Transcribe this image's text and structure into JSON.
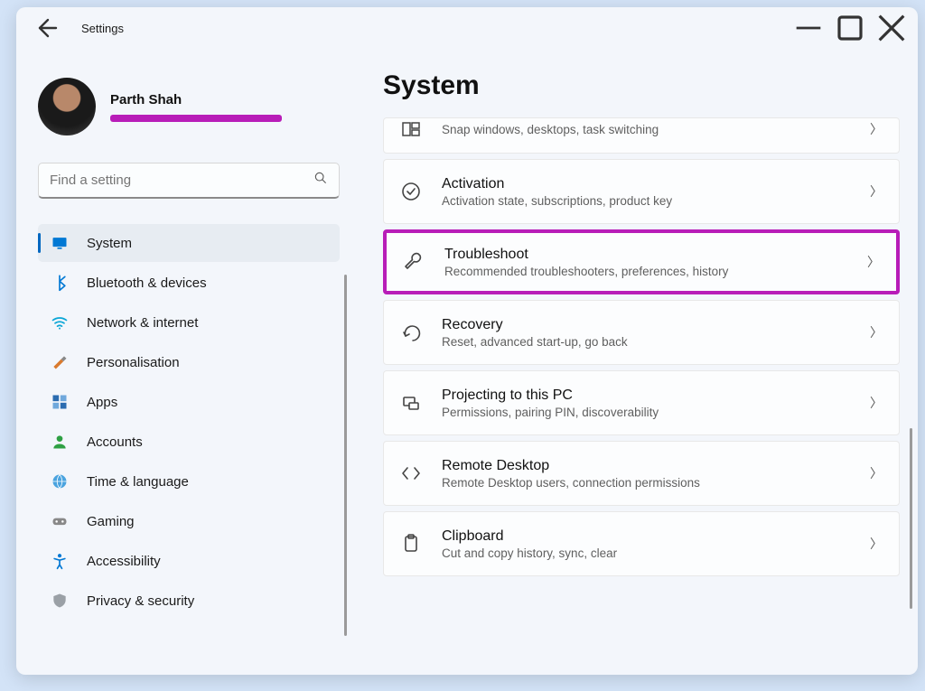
{
  "window": {
    "title": "Settings"
  },
  "profile": {
    "name": "Parth Shah"
  },
  "search": {
    "placeholder": "Find a setting"
  },
  "sidebar": {
    "items": [
      {
        "label": "System",
        "icon": "monitor"
      },
      {
        "label": "Bluetooth & devices",
        "icon": "bluetooth"
      },
      {
        "label": "Network & internet",
        "icon": "wifi"
      },
      {
        "label": "Personalisation",
        "icon": "brush"
      },
      {
        "label": "Apps",
        "icon": "apps"
      },
      {
        "label": "Accounts",
        "icon": "person"
      },
      {
        "label": "Time & language",
        "icon": "globe"
      },
      {
        "label": "Gaming",
        "icon": "gamepad"
      },
      {
        "label": "Accessibility",
        "icon": "accessibility"
      },
      {
        "label": "Privacy & security",
        "icon": "shield"
      }
    ]
  },
  "main": {
    "title": "System",
    "items": [
      {
        "title": "",
        "subtitle": "Snap windows, desktops, task switching",
        "icon": "multitask",
        "partial": true
      },
      {
        "title": "Activation",
        "subtitle": "Activation state, subscriptions, product key",
        "icon": "check-circle"
      },
      {
        "title": "Troubleshoot",
        "subtitle": "Recommended troubleshooters, preferences, history",
        "icon": "wrench",
        "highlight": true
      },
      {
        "title": "Recovery",
        "subtitle": "Reset, advanced start-up, go back",
        "icon": "recovery"
      },
      {
        "title": "Projecting to this PC",
        "subtitle": "Permissions, pairing PIN, discoverability",
        "icon": "project"
      },
      {
        "title": "Remote Desktop",
        "subtitle": "Remote Desktop users, connection permissions",
        "icon": "remote"
      },
      {
        "title": "Clipboard",
        "subtitle": "Cut and copy history, sync, clear",
        "icon": "clipboard"
      }
    ]
  }
}
